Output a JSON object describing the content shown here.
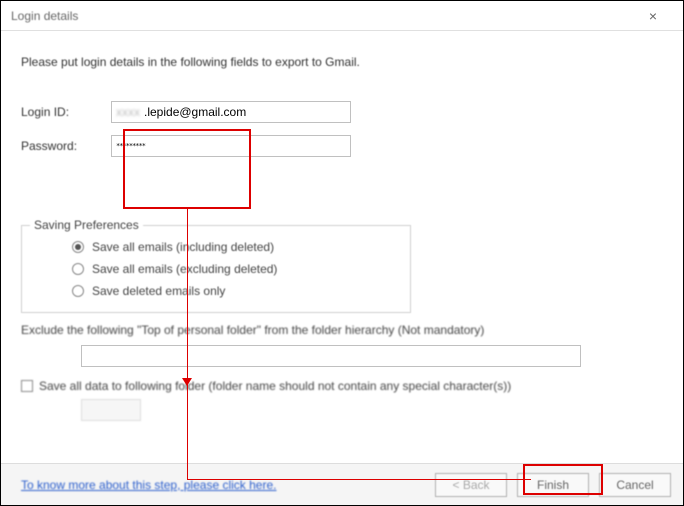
{
  "title": "Login details",
  "instructions": "Please put login details in the following fields to export to Gmail.",
  "labels": {
    "login": "Login ID:",
    "password": "Password:"
  },
  "login": {
    "masked_prefix": "xxxx",
    "value": ".lepide@gmail.com"
  },
  "password": {
    "value": "*********"
  },
  "saving": {
    "legend": "Saving Preferences",
    "opt1": "Save all emails (including deleted)",
    "opt2": "Save all emails (excluding deleted)",
    "opt3": "Save deleted emails only"
  },
  "exclude": {
    "label": "Exclude the following \"Top of personal folder\" from the folder hierarchy  (Not mandatory)",
    "value": ""
  },
  "saveFolder": {
    "label": "Save all data to following folder (folder name should not contain any special character(s))",
    "value": ""
  },
  "link": "To know more about this step, please click here.",
  "buttons": {
    "back": "< Back",
    "finish": "Finish",
    "cancel": "Cancel"
  }
}
